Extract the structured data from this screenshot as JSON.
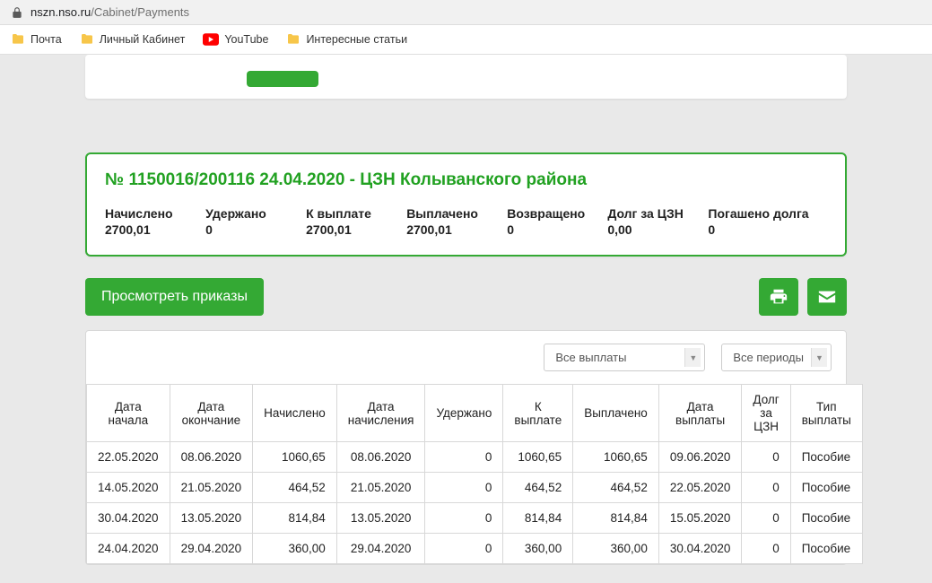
{
  "url": {
    "host": "nszn.nso.ru",
    "path": "/Cabinet/Payments"
  },
  "bookmarks": [
    "Почта",
    "Личный Кабинет",
    "YouTube",
    "Интересные статьи"
  ],
  "summary": {
    "title": "№ 1150016/200116 24.04.2020 - ЦЗН Колыванского района",
    "items": [
      {
        "label": "Начислено",
        "value": "2700,01"
      },
      {
        "label": "Удержано",
        "value": "0"
      },
      {
        "label": "К выплате",
        "value": "2700,01"
      },
      {
        "label": "Выплачено",
        "value": "2700,01"
      },
      {
        "label": "Возвращено",
        "value": "0"
      },
      {
        "label": "Долг за ЦЗН",
        "value": "0,00"
      },
      {
        "label": "Погашено долга",
        "value": "0"
      }
    ]
  },
  "actions": {
    "view_orders": "Просмотреть приказы"
  },
  "filters": {
    "payments": "Все выплаты",
    "periods": "Все периоды"
  },
  "table": {
    "headers": [
      "Дата начала",
      "Дата окончание",
      "Начислено",
      "Дата начисления",
      "Удержано",
      "К выплате",
      "Выплачено",
      "Дата выплаты",
      "Долг за ЦЗН",
      "Тип выплаты"
    ],
    "rows": [
      [
        "22.05.2020",
        "08.06.2020",
        "1060,65",
        "08.06.2020",
        "0",
        "1060,65",
        "1060,65",
        "09.06.2020",
        "0",
        "Пособие"
      ],
      [
        "14.05.2020",
        "21.05.2020",
        "464,52",
        "21.05.2020",
        "0",
        "464,52",
        "464,52",
        "22.05.2020",
        "0",
        "Пособие"
      ],
      [
        "30.04.2020",
        "13.05.2020",
        "814,84",
        "13.05.2020",
        "0",
        "814,84",
        "814,84",
        "15.05.2020",
        "0",
        "Пособие"
      ],
      [
        "24.04.2020",
        "29.04.2020",
        "360,00",
        "29.04.2020",
        "0",
        "360,00",
        "360,00",
        "30.04.2020",
        "0",
        "Пособие"
      ]
    ]
  }
}
